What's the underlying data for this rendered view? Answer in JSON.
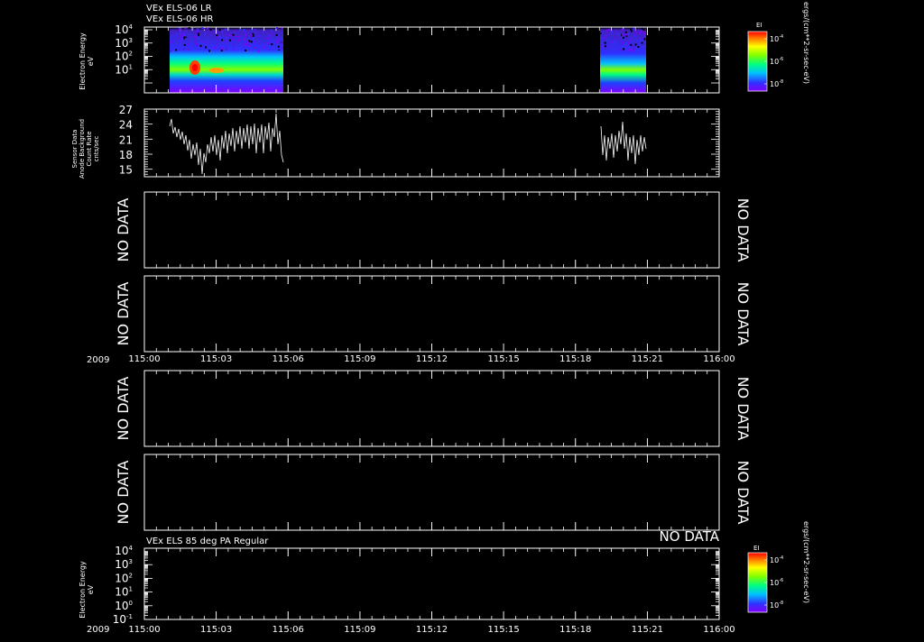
{
  "header": {
    "title_lr": "VEx ELS-06 LR",
    "title_hr": "VEx ELS-06 HR",
    "title_pa": "VEx ELS 85 deg PA Regular"
  },
  "no_data_text": "NO DATA",
  "time_axis": {
    "year": "2009",
    "ticks": [
      "115:00",
      "115:03",
      "115:06",
      "115:09",
      "115:12",
      "115:15",
      "115:18",
      "115:21",
      "116:00"
    ]
  },
  "colorbar": {
    "title": "EI",
    "unit": "ergs/(cm**2-sr-sec-eV)",
    "tick_labels": [
      {
        "base": "10",
        "exp": "-4"
      },
      {
        "base": "10",
        "exp": "-6"
      },
      {
        "base": "10",
        "exp": "-8"
      }
    ],
    "colors": [
      "#8000ff",
      "#3030ff",
      "#00c0ff",
      "#00ff80",
      "#80ff00",
      "#ffff00",
      "#ff8000",
      "#ff0000"
    ]
  },
  "chart_data": [
    {
      "type": "heatmap",
      "title": "VEx ELS-06 LR / VEx ELS-06 HR",
      "ylabel": "Electron Energy eV",
      "yscale": "log",
      "ylim": [
        1,
        10000
      ],
      "y_tick_labels": [
        {
          "base": "10",
          "exp": "4"
        },
        {
          "base": "10",
          "exp": "3"
        },
        {
          "base": "10",
          "exp": "2"
        },
        {
          "base": "10",
          "exp": "1"
        }
      ],
      "x_tick_labels": [
        "115:00",
        "115:03",
        "115:06",
        "115:09",
        "115:12",
        "115:15",
        "115:18",
        "115:21",
        "116:00"
      ],
      "colorbar_title": "EI",
      "colorbar_unit": "ergs/(cm**2-sr-sec-eV)",
      "data_intervals": [
        {
          "start": "115:00:40",
          "end": "115:05:40"
        },
        {
          "start": "115:18:40",
          "end": "115:20:40"
        }
      ]
    },
    {
      "type": "line",
      "ylabel": "Sensor Data Anode Background Count Rate cnts/sec",
      "ylim": [
        13.5,
        27
      ],
      "y_ticks": [
        15,
        18,
        21,
        24,
        27
      ],
      "x_tick_labels": [
        "115:00",
        "115:03",
        "115:06",
        "115:09",
        "115:12",
        "115:15",
        "115:18",
        "115:21",
        "116:00"
      ],
      "series": [
        {
          "x": [
            "115:00:40",
            "115:01:20",
            "115:02:00",
            "115:02:40",
            "115:03:20",
            "115:04:00",
            "115:04:40",
            "115:05:20",
            "115:05:40"
          ],
          "y": [
            22.0,
            20.5,
            19.0,
            17.5,
            19.5,
            21.0,
            21.5,
            22.0,
            17.0
          ]
        },
        {
          "x": [
            "115:18:40",
            "115:19:10",
            "115:19:40",
            "115:20:10",
            "115:20:40"
          ],
          "y": [
            18.5,
            20.5,
            21.0,
            20.0,
            19.0
          ]
        }
      ]
    },
    {
      "type": "heatmap",
      "label": "NO DATA"
    },
    {
      "type": "heatmap",
      "label": "NO DATA"
    },
    {
      "type": "heatmap",
      "label": "NO DATA"
    },
    {
      "type": "heatmap",
      "label": "NO DATA"
    },
    {
      "type": "heatmap",
      "title": "VEx ELS 85 deg PA Regular",
      "label": "NO DATA",
      "ylabel": "Electron Energy eV",
      "yscale": "log",
      "ylim": [
        0.1,
        10000
      ],
      "y_tick_labels": [
        {
          "base": "10",
          "exp": "4"
        },
        {
          "base": "10",
          "exp": "3"
        },
        {
          "base": "10",
          "exp": "2"
        },
        {
          "base": "10",
          "exp": "1"
        },
        {
          "base": "10",
          "exp": "0"
        },
        {
          "base": "10",
          "exp": "-1"
        }
      ],
      "x_tick_labels": [
        "115:00",
        "115:03",
        "115:06",
        "115:09",
        "115:12",
        "115:15",
        "115:18",
        "115:21",
        "116:00"
      ],
      "colorbar_title": "EI",
      "colorbar_unit": "ergs/(cm**2-sr-sec-eV)"
    }
  ]
}
